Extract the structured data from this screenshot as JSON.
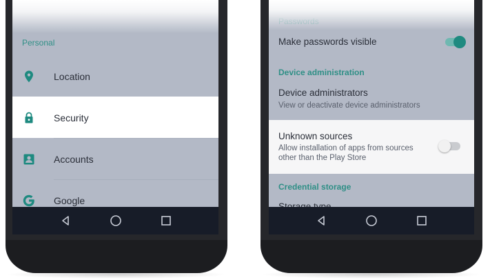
{
  "left_screen": {
    "section_header": "Personal",
    "items": [
      {
        "label": "Location",
        "icon": "location-pin-icon",
        "selected": false
      },
      {
        "label": "Security",
        "icon": "lock-icon",
        "selected": true
      },
      {
        "label": "Accounts",
        "icon": "account-box-icon",
        "selected": false
      },
      {
        "label": "Google",
        "icon": "google-g-icon",
        "selected": false
      }
    ]
  },
  "right_screen": {
    "faded_header": "Passwords",
    "make_passwords_visible": {
      "label": "Make passwords visible",
      "toggle_on": true
    },
    "device_admin_header": "Device administration",
    "device_admins": {
      "title": "Device administrators",
      "subtitle": "View or deactivate device administrators"
    },
    "unknown_sources": {
      "title": "Unknown sources",
      "subtitle_line1": "Allow installation of apps from sources",
      "subtitle_line2": "other than the Play Store",
      "toggle_on": false
    },
    "credential_header": "Credential storage",
    "storage_type_partial": "Storage type"
  },
  "navbar": {
    "back": "back-icon",
    "home": "home-icon",
    "recents": "recents-icon"
  },
  "colors": {
    "accent": "#2f8f86",
    "screen_bg": "#b3b9c6",
    "selected_bg": "#ffffff",
    "navbar_bg": "#171c28"
  }
}
